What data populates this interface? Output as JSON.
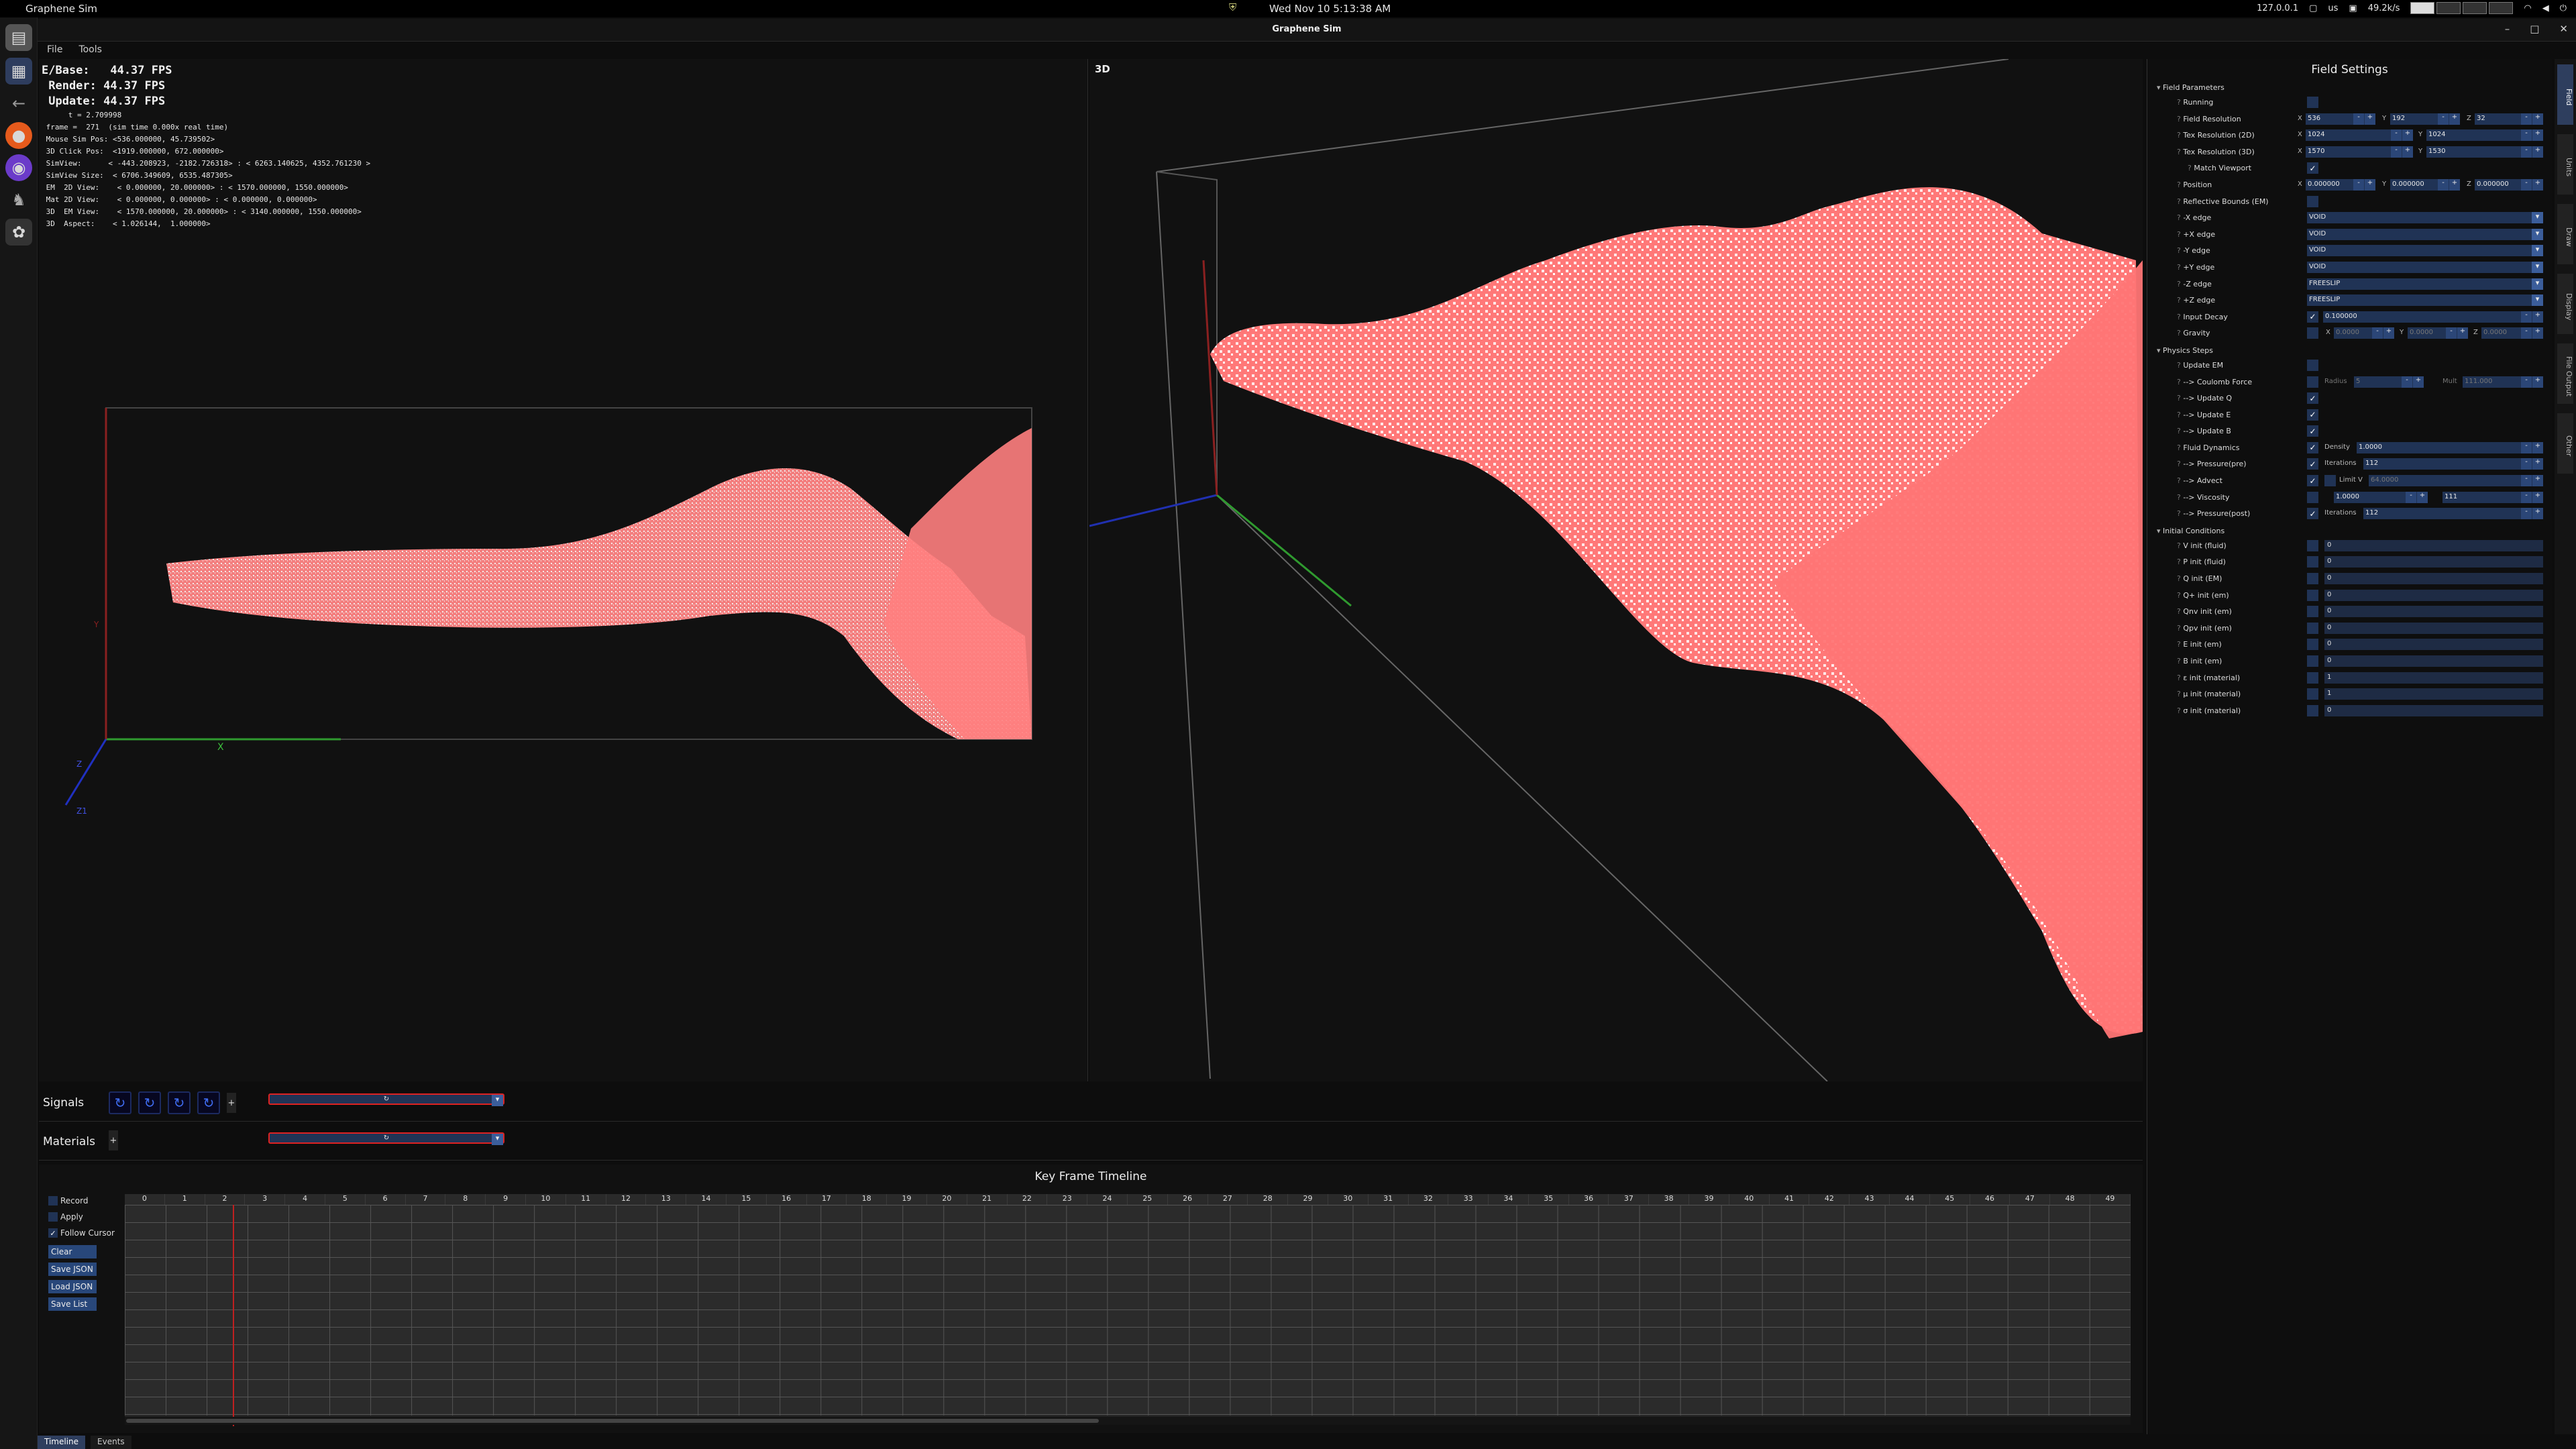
{
  "topbar": {
    "app_name": "Graphene Sim",
    "clock": "Wed Nov 10   5:13:38 AM",
    "ip": "127.0.0.1",
    "lang": "us",
    "net": "49.2k/s",
    "ai_glyph": "⛨"
  },
  "window": {
    "title": "Graphene Sim"
  },
  "menu": {
    "file": "File",
    "tools": "Tools"
  },
  "stats": {
    "fps": "E/Base:   44.37 FPS\n Render: 44.37 FPS\n Update: 44.37 FPS",
    "debug": "      t = 2.709998\n frame =  271  (sim time 0.000x real time)\n Mouse Sim Pos: <536.000000, 45.739502>\n 3D Click Pos:  <1919.000000, 672.000000>\n SimView:      < -443.208923, -2182.726318> : < 6263.140625, 4352.761230 >\n SimView Size:  < 6706.349609, 6535.487305>\n EM  2D View:    < 0.000000, 20.000000> : < 1570.000000, 1550.000000>\n Mat 2D View:    < 0.000000, 0.000000> : < 0.000000, 0.000000>\n 3D  EM View:    < 1570.000000, 20.000000> : < 3140.000000, 1550.000000>\n 3D  Aspect:    < 1.026144,  1.000000>"
  },
  "view2d": {
    "x_axis": "X",
    "y_axis": "Y",
    "z_axis": "Z",
    "z_label": "Z1"
  },
  "view3d": {
    "label": "3D"
  },
  "signals": {
    "label": "Signals",
    "count": 5,
    "add": "+"
  },
  "materials": {
    "label": "Materials",
    "add": "+"
  },
  "timeline": {
    "title": "Key Frame Timeline",
    "record": "Record",
    "apply": "Apply",
    "follow": "Follow Cursor",
    "clear": "Clear",
    "save_json": "Save JSON",
    "load_json": "Load JSON",
    "save_list": "Save List",
    "frames": [
      "0",
      "1",
      "2",
      "3",
      "4",
      "5",
      "6",
      "7",
      "8",
      "9",
      "10",
      "11",
      "12",
      "13",
      "14",
      "15",
      "16",
      "17",
      "18",
      "19",
      "20",
      "21",
      "22",
      "23",
      "24",
      "25",
      "26",
      "27",
      "28",
      "29",
      "30",
      "31",
      "32",
      "33",
      "34",
      "35",
      "36",
      "37",
      "38",
      "39",
      "40",
      "41",
      "42",
      "43",
      "44",
      "45",
      "46",
      "47",
      "48",
      "49"
    ],
    "cursor_frame": 2.2
  },
  "bottom_tabs": {
    "timeline": "Timeline",
    "events": "Events"
  },
  "settings": {
    "title": "Field Settings",
    "sections": {
      "field": "Field Parameters",
      "physics": "Physics Steps",
      "initial": "Initial Conditions"
    },
    "labels": {
      "running": "Running",
      "field_res": "Field Resolution",
      "tex2d": "Tex Resolution (2D)",
      "tex3d": "Tex Resolution (3D)",
      "match": "Match Viewport",
      "position": "Position",
      "reflective": "Reflective Bounds (EM)",
      "mx": "-X edge",
      "px": "+X edge",
      "my": "-Y edge",
      "py": "+Y edge",
      "mz": "-Z edge",
      "pz": "+Z edge",
      "decay": "Input Decay",
      "gravity": "Gravity",
      "update_em": "Update EM",
      "coulomb": " --> Coulomb Force",
      "uq": " --> Update Q",
      "ue": " --> Update E",
      "ub": " --> Update B",
      "fluid": "Fluid Dynamics",
      "pre": " --> Pressure(pre)",
      "advect": " --> Advect",
      "visc": " --> Viscosity",
      "post": " --> Pressure(post)",
      "v_init": "V  init (fluid)",
      "p_init": "P  init (fluid)",
      "q_init": "Q  init (EM)",
      "qp_init": "Q+ init (em)",
      "qnv_init": "Qnv init (em)",
      "qpv_init": "Qpv init (em)",
      "e_init": "E  init (em)",
      "b_init": "B  init (em)",
      "eps_init": "ε  init (material)",
      "mu_init": "μ  init (material)",
      "sig_init": "σ  init (material)"
    },
    "values": {
      "field_x": "536",
      "field_y": "192",
      "field_z": "32",
      "tex2d_x": "1024",
      "tex2d_y": "1024",
      "tex3d_x": "1570",
      "tex3d_y": "1530",
      "pos_x": "0.000000",
      "pos_y": "0.000000",
      "pos_z": "0.000000",
      "mx": "VOID",
      "px": "VOID",
      "my": "VOID",
      "py": "VOID",
      "mz": "FREESLIP",
      "pz": "FREESLIP",
      "decay": "0.100000",
      "grav_x": "0.0000",
      "grav_y": "0.0000",
      "grav_z": "0.0000",
      "radius_lbl": "Radius",
      "radius": "5",
      "mult_lbl": "Mult",
      "mult": "111.000",
      "density_lbl": "Density",
      "density": "1.0000",
      "iter_lbl": "Iterations",
      "iter_pre": "112",
      "limitv_lbl": "Limit V",
      "limitv": "64.0000",
      "visc": "1.0000",
      "visc_iter": "111",
      "iter_post": "112",
      "init": [
        "0",
        "0",
        "0",
        "0",
        "0",
        "0",
        "0",
        "0",
        "1",
        "1",
        "0"
      ]
    }
  },
  "right_tabs": [
    "Field",
    "Units",
    "Draw",
    "Display",
    "File Output",
    "Other"
  ]
}
